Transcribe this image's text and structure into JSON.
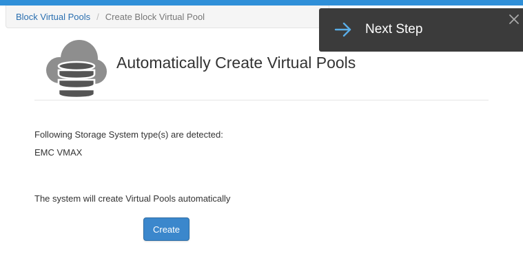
{
  "breadcrumb": {
    "items": [
      {
        "label": "Block Virtual Pools"
      },
      {
        "label": "Create Block Virtual Pool"
      }
    ],
    "separator": "/"
  },
  "next_step": {
    "label": "Next Step",
    "icon": "arrow-right-icon",
    "close_icon": "close-icon"
  },
  "main": {
    "icon": "cloud-database-icon",
    "title": "Automatically Create Virtual Pools",
    "detected_label": "Following Storage System type(s) are detected:",
    "detected_value": "EMC VMAX",
    "info_text": "The system will create Virtual Pools automatically",
    "create_label": "Create"
  },
  "colors": {
    "topbar": "#2f8fd8",
    "link": "#2a6fb0",
    "primary_button": "#3b87cc",
    "next_step_bg": "#3b3b3b",
    "arrow": "#5aaee8"
  }
}
